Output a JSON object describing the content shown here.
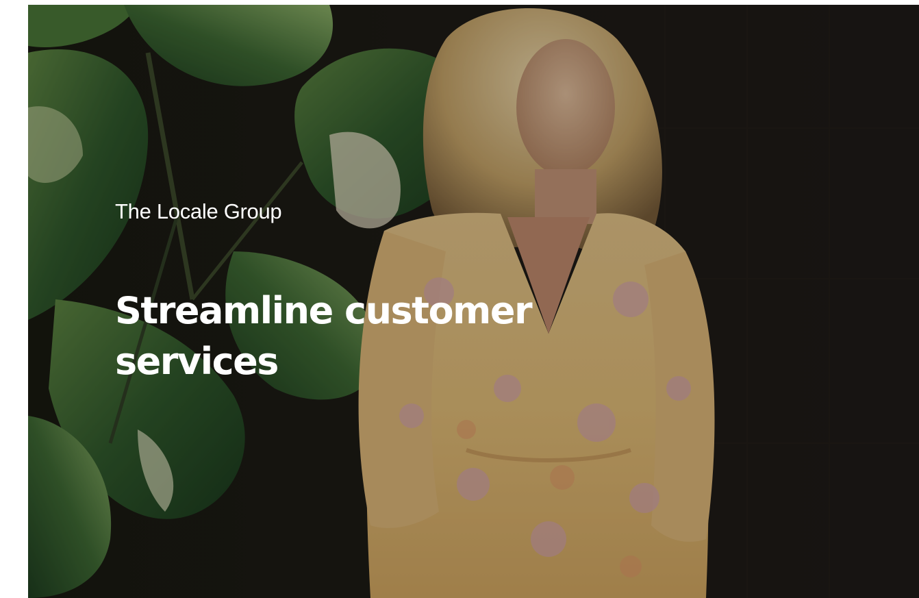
{
  "hero": {
    "eyebrow": "The Locale Group",
    "headline": "Streamline customer services",
    "photo_icon": "fashion-model-photo",
    "colors": {
      "background": "#191613",
      "text": "#ffffff",
      "leaf_dark": "#1f4a25",
      "leaf_light": "#7fa85a",
      "dress": "#e8c787",
      "hair": "#d9c08a"
    }
  }
}
